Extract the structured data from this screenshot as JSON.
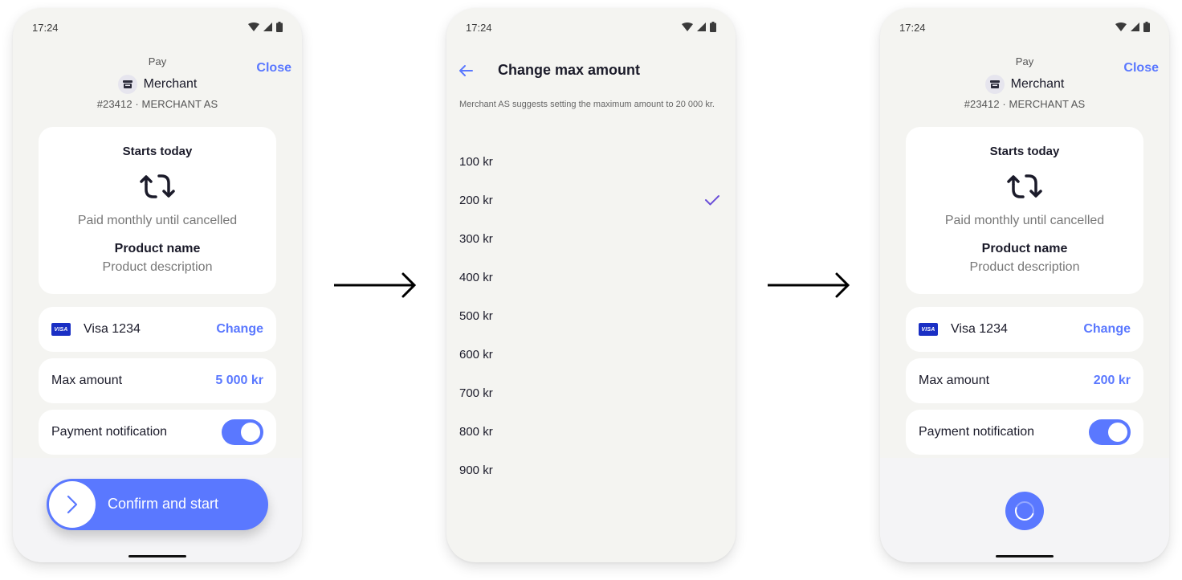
{
  "status_bar": {
    "time": "17:24"
  },
  "screens": [
    {
      "header": {
        "title": "Pay",
        "close_label": "Close",
        "merchant_name": "Merchant",
        "merchant_sub": "#23412 · MERCHANT AS"
      },
      "summary": {
        "starts": "Starts today",
        "frequency": "Paid monthly until cancelled",
        "product_name": "Product name",
        "product_description": "Product description"
      },
      "payment_method": {
        "card_brand": "VISA",
        "label": "Visa 1234",
        "action": "Change"
      },
      "max_amount": {
        "label": "Max amount",
        "value": "5 000 kr"
      },
      "notification": {
        "label": "Payment notification",
        "enabled": true
      },
      "confirm_label": "Confirm and start"
    },
    {
      "title": "Change max amount",
      "note": "Merchant AS suggests setting the maximum amount to 20 000 kr.",
      "options": [
        {
          "label": "100 kr",
          "selected": false
        },
        {
          "label": "200 kr",
          "selected": true
        },
        {
          "label": "300 kr",
          "selected": false
        },
        {
          "label": "400 kr",
          "selected": false
        },
        {
          "label": "500 kr",
          "selected": false
        },
        {
          "label": "600 kr",
          "selected": false
        },
        {
          "label": "700 kr",
          "selected": false
        },
        {
          "label": "800 kr",
          "selected": false
        },
        {
          "label": "900 kr",
          "selected": false
        }
      ]
    },
    {
      "header": {
        "title": "Pay",
        "close_label": "Close",
        "merchant_name": "Merchant",
        "merchant_sub": "#23412 · MERCHANT AS"
      },
      "summary": {
        "starts": "Starts today",
        "frequency": "Paid monthly until cancelled",
        "product_name": "Product name",
        "product_description": "Product description"
      },
      "payment_method": {
        "card_brand": "VISA",
        "label": "Visa 1234",
        "action": "Change"
      },
      "max_amount": {
        "label": "Max amount",
        "value": "200 kr"
      },
      "notification": {
        "label": "Payment notification",
        "enabled": true
      },
      "state": "loading"
    }
  ],
  "colors": {
    "accent": "#5a78ff",
    "check": "#6b4fd8",
    "visa": "#1a2fc4",
    "background": "#f4f4f1"
  }
}
